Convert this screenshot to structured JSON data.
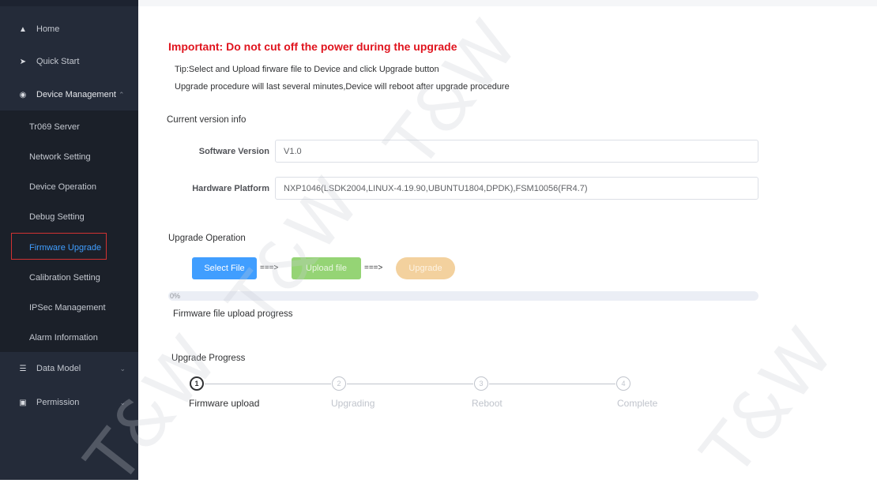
{
  "sidebar": {
    "items": [
      {
        "label": "Home",
        "icon": "home-icon"
      },
      {
        "label": "Quick Start",
        "icon": "send-icon"
      },
      {
        "label": "Device Management",
        "icon": "gear-icon"
      },
      {
        "label": "Data Model",
        "icon": "database-icon"
      },
      {
        "label": "Permission",
        "icon": "id-card-icon"
      }
    ],
    "submenu": [
      "Tr069 Server",
      "Network Setting",
      "Device Operation",
      "Debug Setting",
      "Firmware Upgrade",
      "Calibration Setting",
      "IPSec Management",
      "Alarm Information"
    ],
    "active": "Firmware Upgrade"
  },
  "page": {
    "warning": "Important: Do not cut off the power during the upgrade",
    "tip1": "Tip:Select and Upload firware file to Device and click Upgrade button",
    "tip2": "Upgrade procedure will last several minutes,Device will reboot after upgrade procedure",
    "version_section": "Current version info",
    "software_label": "Software Version",
    "software_value": "V1.0",
    "hardware_label": "Hardware Platform",
    "hardware_value": "NXP1046(LSDK2004,LINUX-4.19.90,UBUNTU1804,DPDK),FSM10056(FR4.7)",
    "operation_section": "Upgrade Operation",
    "select_file": "Select File",
    "upload_file": "Upload file",
    "upgrade": "Upgrade",
    "arrow": "===>",
    "upload_percent_text": "0%",
    "upload_percent": 0,
    "upload_caption": "Firmware file upload progress",
    "progress_section": "Upgrade Progress",
    "steps": [
      {
        "num": "1",
        "label": "Firmware upload"
      },
      {
        "num": "2",
        "label": "Upgrading"
      },
      {
        "num": "3",
        "label": "Reboot"
      },
      {
        "num": "4",
        "label": "Complete"
      }
    ],
    "current_step": 1
  },
  "watermark_text": "T&W",
  "colors": {
    "sidebar_bg": "#242b39",
    "submenu_bg": "#1b2029",
    "accent": "#409eff",
    "warning": "#e0141e",
    "upload_btn": "#95d475",
    "upgrade_btn": "#f3d19e"
  }
}
